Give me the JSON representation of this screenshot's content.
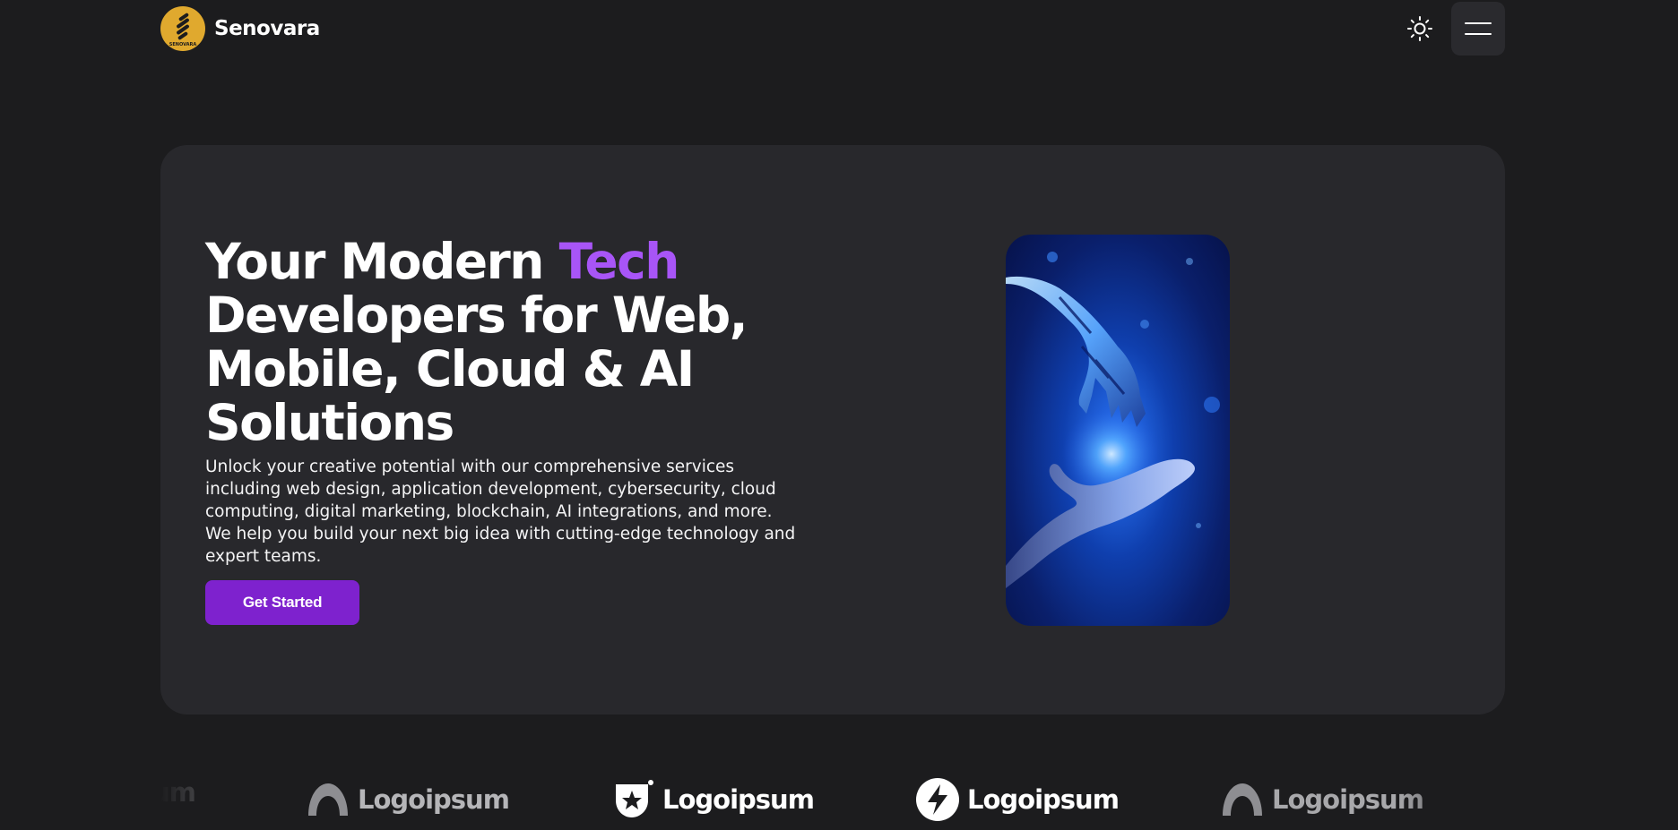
{
  "brand": {
    "name": "Senovara",
    "logo_text": "SENOVARA",
    "logo_color": "#e0a92e"
  },
  "header": {
    "theme_icon": "sun-icon",
    "menu_icon": "hamburger-menu-icon"
  },
  "hero": {
    "title_part1": "Your Modern ",
    "title_accent": "Tech",
    "title_part2": "Developers for Web, Mobile, Cloud & AI Solutions",
    "accent_color": "#a855f7",
    "description": "Unlock your creative potential with our comprehensive services including web design, application development, cybersecurity, cloud computing, digital marketing, blockchain, AI integrations, and more. We help you build your next big idea with cutting-edge technology and expert teams.",
    "cta_label": "Get Started",
    "cta_color": "#7e22ce",
    "image_icon": "robot-hand-reaching-human-hand-image"
  },
  "partners": {
    "logos": [
      {
        "label": "um",
        "icon": "arch-logo-icon"
      },
      {
        "label": "Logoipsum",
        "icon": "arch-logo-icon"
      },
      {
        "label": "Logoipsum",
        "icon": "star-badge-logo-icon"
      },
      {
        "label": "Logoipsum",
        "icon": "bolt-circle-logo-icon"
      },
      {
        "label": "Logoipsum",
        "icon": "arch-logo-icon"
      }
    ]
  }
}
